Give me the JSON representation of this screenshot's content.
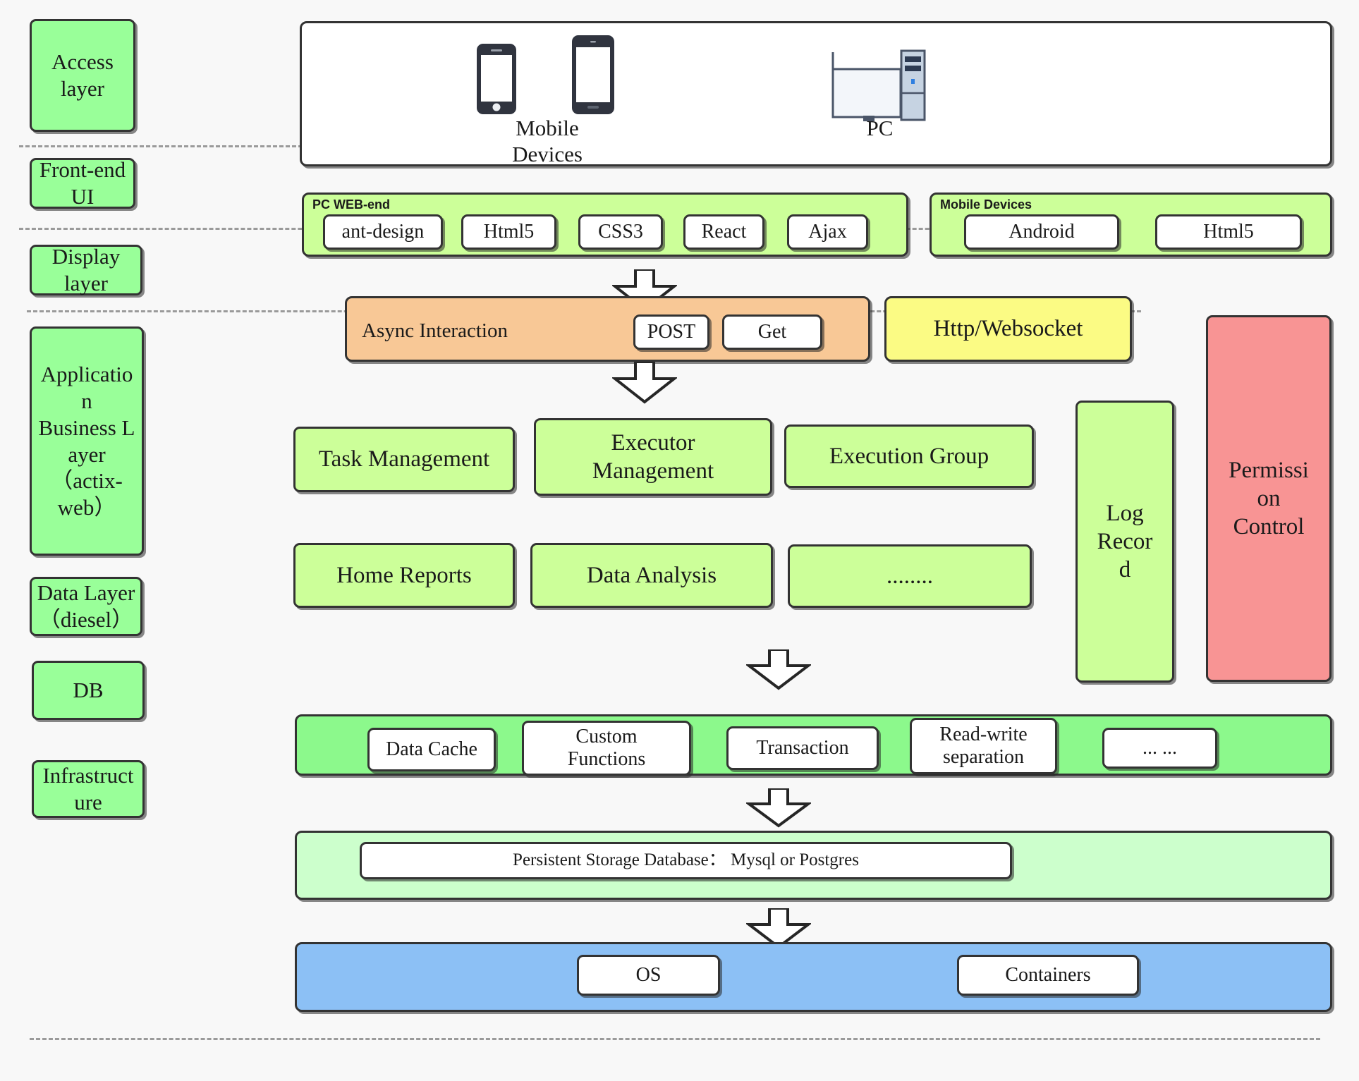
{
  "layers": [
    {
      "id": "access",
      "label": "Access\nlayer"
    },
    {
      "id": "frontend",
      "label": "Front-end\nUI"
    },
    {
      "id": "display",
      "label": "Display\nlayer"
    },
    {
      "id": "application",
      "label": "Applicatio\nn\nBusiness L\nayer\n（actix-\nweb）"
    },
    {
      "id": "datalayer",
      "label": "Data Layer\n（diesel）"
    },
    {
      "id": "db",
      "label": "DB"
    },
    {
      "id": "infrastructure",
      "label": "Infrastruct\nure"
    }
  ],
  "access_layer": {
    "devices": [
      {
        "name": "mobile",
        "caption": "Mobile\nDevices"
      },
      {
        "name": "pc",
        "caption": "PC"
      }
    ]
  },
  "frontend": {
    "pc_group": {
      "title": "PC WEB-end",
      "items": [
        "ant-design",
        "Html5",
        "CSS3",
        "React",
        "Ajax"
      ]
    },
    "mobile_group": {
      "title": "Mobile Devices",
      "items": [
        "Android",
        "Html5"
      ]
    }
  },
  "display": {
    "async_label": "Async Interaction",
    "methods": [
      "POST",
      "Get"
    ],
    "protocol": "Http/Websocket"
  },
  "business": {
    "row1": [
      "Task Management",
      "Executor\nManagement",
      "Execution Group"
    ],
    "row2": [
      "Home Reports",
      "Data Analysis",
      "........"
    ],
    "log_record": "Log\nRecor\nd",
    "permission_control": "Permissi\non\nControl"
  },
  "data_layer": {
    "items": [
      "Data Cache",
      "Custom\nFunctions",
      "Transaction",
      "Read-write\nseparation",
      "... ..."
    ]
  },
  "db_layer": {
    "database": "Persistent Storage Database：  Mysql or Postgres"
  },
  "infrastructure": {
    "items": [
      "OS",
      "Containers"
    ]
  },
  "colors": {
    "layer_label": "#99ff99",
    "frontend_band": "#ccff99",
    "business_box": "#ccff99",
    "async_band": "#f8c896",
    "protocol_box": "#fbfb84",
    "permission_box": "#f89494",
    "data_band": "#8cf98c",
    "db_band": "#ccffcc",
    "infra_band": "#8cc0f5",
    "border": "#333333",
    "background": "#f8f8f8"
  }
}
